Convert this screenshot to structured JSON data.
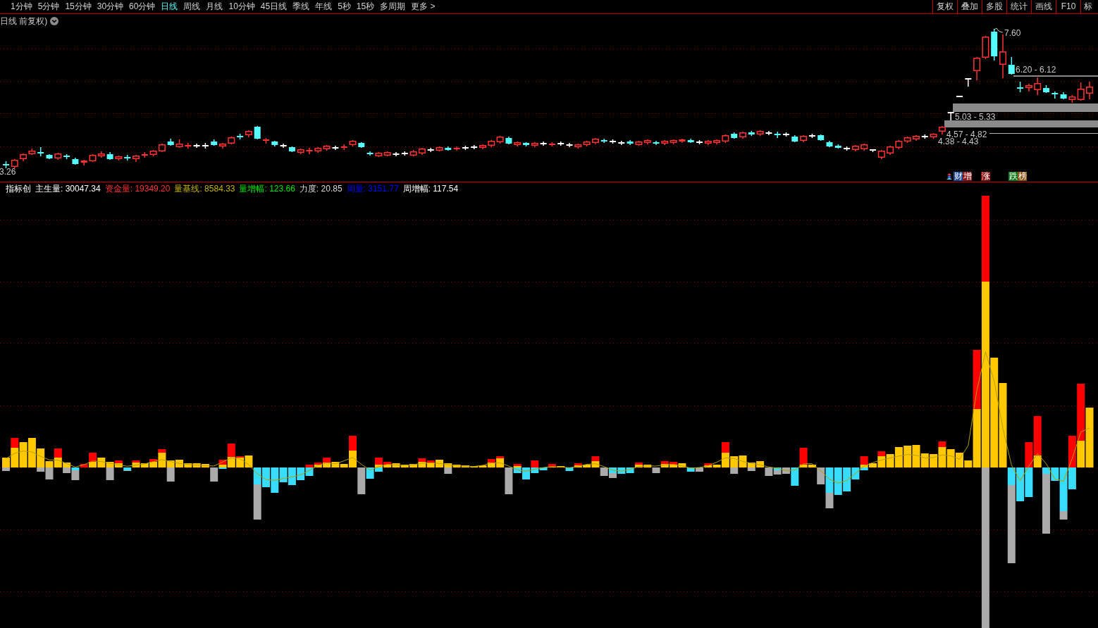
{
  "toolbar": {
    "periods": [
      {
        "label": "1分钟",
        "selected": false
      },
      {
        "label": "5分钟",
        "selected": false
      },
      {
        "label": "15分钟",
        "selected": false
      },
      {
        "label": "30分钟",
        "selected": false
      },
      {
        "label": "60分钟",
        "selected": false
      },
      {
        "label": "日线",
        "selected": true
      },
      {
        "label": "周线",
        "selected": false
      },
      {
        "label": "月线",
        "selected": false
      },
      {
        "label": "10分钟",
        "selected": false
      },
      {
        "label": "45日线",
        "selected": false
      },
      {
        "label": "季线",
        "selected": false
      },
      {
        "label": "年线",
        "selected": false
      },
      {
        "label": "5秒",
        "selected": false
      },
      {
        "label": "15秒",
        "selected": false
      },
      {
        "label": "多周期",
        "selected": false
      },
      {
        "label": "更多 >",
        "selected": false
      }
    ],
    "tools": [
      "复权",
      "叠加",
      "多股",
      "统计",
      "画线",
      "F10",
      "标"
    ]
  },
  "price_pane": {
    "title": "日线 前复权)",
    "price_labels": [
      "7.60",
      "6.20 - 6.12",
      "5.03 - 5.33",
      "4.57 - 4.82",
      "4.38 - 4.43",
      "3.26"
    ],
    "tag_groups": [
      {
        "tags": [
          {
            "text": "财",
            "color": "#1e4a96"
          },
          {
            "text": "增",
            "color": "#8c1414"
          }
        ]
      },
      {
        "tags": [
          {
            "text": "涨",
            "color": "#8c1414"
          }
        ]
      },
      {
        "tags": [
          {
            "text": "跌",
            "color": "#12781e"
          },
          {
            "text": "榜",
            "color": "#8c5514"
          }
        ]
      }
    ]
  },
  "indicator_pane": {
    "name": "指标创",
    "readings": [
      {
        "text": "主生量: 30047.34",
        "color": "#ffffff"
      },
      {
        "text": "资金量: 19349.20",
        "color": "#ff3232"
      },
      {
        "text": "量基线: 8584.33",
        "color": "#c8b400"
      },
      {
        "text": "量增幅: 123.66",
        "color": "#00e600"
      },
      {
        "text": "力度: 20.85",
        "color": "#dcdcdc"
      },
      {
        "text": "周量: 3151.77",
        "color": "#0000ff"
      },
      {
        "text": "周增幅: 117.54",
        "color": "#ffffff"
      }
    ]
  }
}
